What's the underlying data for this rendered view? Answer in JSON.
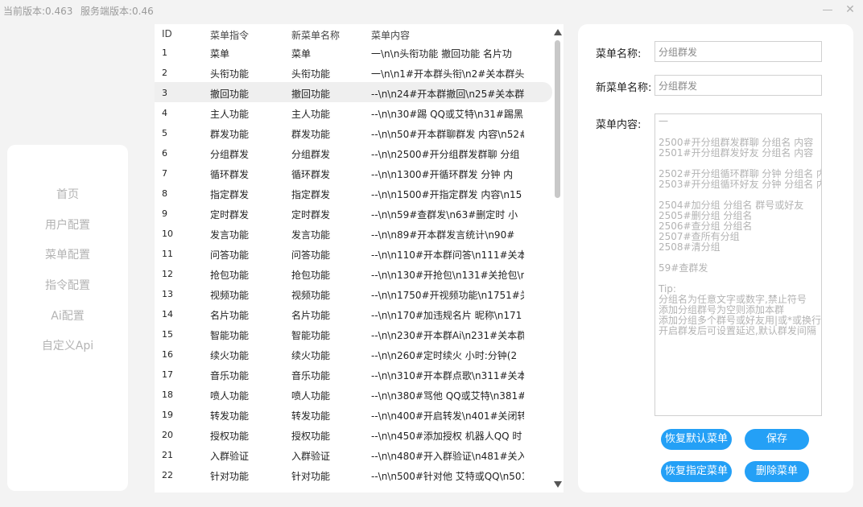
{
  "topbar": {
    "current_version": "当前版本:0.463",
    "server_version": "服务端版本:0.46"
  },
  "sidebar": {
    "items": [
      {
        "label": "首页"
      },
      {
        "label": "用户配置"
      },
      {
        "label": "菜单配置"
      },
      {
        "label": "指令配置"
      },
      {
        "label": "Ai配置"
      },
      {
        "label": "自定义Api"
      }
    ]
  },
  "table": {
    "headers": {
      "id": "ID",
      "menu": "菜单指令",
      "new_name": "新菜单名称",
      "content": "菜单内容"
    },
    "selected_index": 2,
    "rows": [
      {
        "id": "1",
        "menu": "菜单",
        "new_name": "菜单",
        "content": "一\\n\\n头衔功能 撤回功能 名片功"
      },
      {
        "id": "2",
        "menu": "头衔功能",
        "new_name": "头衔功能",
        "content": "一\\n\\n1#开本群头衔\\n2#关本群头"
      },
      {
        "id": "3",
        "menu": "撤回功能",
        "new_name": "撤回功能",
        "content": "--\\n\\n24#开本群撤回\\n25#关本群"
      },
      {
        "id": "4",
        "menu": "主人功能",
        "new_name": "主人功能",
        "content": "--\\n\\n30#踢 QQ或艾特\\n31#踢黑"
      },
      {
        "id": "5",
        "menu": "群发功能",
        "new_name": "群发功能",
        "content": "--\\n\\n50#开本群聊群发 内容\\n52#"
      },
      {
        "id": "6",
        "menu": "分组群发",
        "new_name": "分组群发",
        "content": "--\\n\\n2500#开分组群发群聊 分组"
      },
      {
        "id": "7",
        "menu": "循环群发",
        "new_name": "循环群发",
        "content": "--\\n\\n1300#开循环群发 分钟 内"
      },
      {
        "id": "8",
        "menu": "指定群发",
        "new_name": "指定群发",
        "content": "--\\n\\n1500#开指定群发 内容\\n15"
      },
      {
        "id": "9",
        "menu": "定时群发",
        "new_name": "定时群发",
        "content": "--\\n\\n59#查群发\\n63#删定时 小"
      },
      {
        "id": "10",
        "menu": "发言功能",
        "new_name": "发言功能",
        "content": "--\\n\\n89#开本群发言统计\\n90#"
      },
      {
        "id": "11",
        "menu": "问答功能",
        "new_name": "问答功能",
        "content": "--\\n\\n110#开本群问答\\n111#关本"
      },
      {
        "id": "12",
        "menu": "抢包功能",
        "new_name": "抢包功能",
        "content": "--\\n\\n130#开抢包\\n131#关抢包\\n"
      },
      {
        "id": "13",
        "menu": "视频功能",
        "new_name": "视频功能",
        "content": "--\\n\\n1750#开视频功能\\n1751#关"
      },
      {
        "id": "14",
        "menu": "名片功能",
        "new_name": "名片功能",
        "content": "--\\n\\n170#加违规名片 昵称\\n171"
      },
      {
        "id": "15",
        "menu": "智能功能",
        "new_name": "智能功能",
        "content": "--\\n\\n230#开本群Ai\\n231#关本群"
      },
      {
        "id": "16",
        "menu": "续火功能",
        "new_name": "续火功能",
        "content": "--\\n\\n260#定时续火 小时:分钟(2"
      },
      {
        "id": "17",
        "menu": "音乐功能",
        "new_name": "音乐功能",
        "content": "--\\n\\n310#开本群点歌\\n311#关本"
      },
      {
        "id": "18",
        "menu": "喷人功能",
        "new_name": "喷人功能",
        "content": "--\\n\\n380#骂他 QQ或艾特\\n381#"
      },
      {
        "id": "19",
        "menu": "转发功能",
        "new_name": "转发功能",
        "content": "--\\n\\n400#开启转发\\n401#关闭转"
      },
      {
        "id": "20",
        "menu": "授权功能",
        "new_name": "授权功能",
        "content": "--\\n\\n450#添加授权 机器人QQ 时"
      },
      {
        "id": "21",
        "menu": "入群验证",
        "new_name": "入群验证",
        "content": "--\\n\\n480#开入群验证\\n481#关入"
      },
      {
        "id": "22",
        "menu": "针对功能",
        "new_name": "针对功能",
        "content": "--\\n\\n500#针对他 艾特或QQ\\n501"
      }
    ]
  },
  "form": {
    "menu_name_label": "菜单名称:",
    "menu_name_value": "分组群发",
    "new_menu_name_label": "新菜单名称:",
    "new_menu_name_value": "分组群发",
    "content_label": "菜单内容:",
    "content_value": "一\n\n2500#开分组群发群聊 分组名 内容\n2501#开分组群发好友 分组名 内容\n\n2502#开分组循环群聊 分钟 分组名 内\n2503#开分组循环好友 分钟 分组名 内\n\n2504#加分组 分组名 群号或好友\n2505#删分组 分组名\n2506#查分组 分组名\n2507#查所有分组\n2508#清分组\n\n59#查群发\n\nTip:\n分组名为任意文字或数字,禁止符号\n添加分组群号为空则添加本群\n添加分组多个群号或好友用|或*或换行\n开启群发后可设置延迟,默认群发间隔"
  },
  "buttons": {
    "restore_default": "恢复默认菜单",
    "save": "保存",
    "restore_specified": "恢复指定菜单",
    "delete": "删除菜单"
  }
}
